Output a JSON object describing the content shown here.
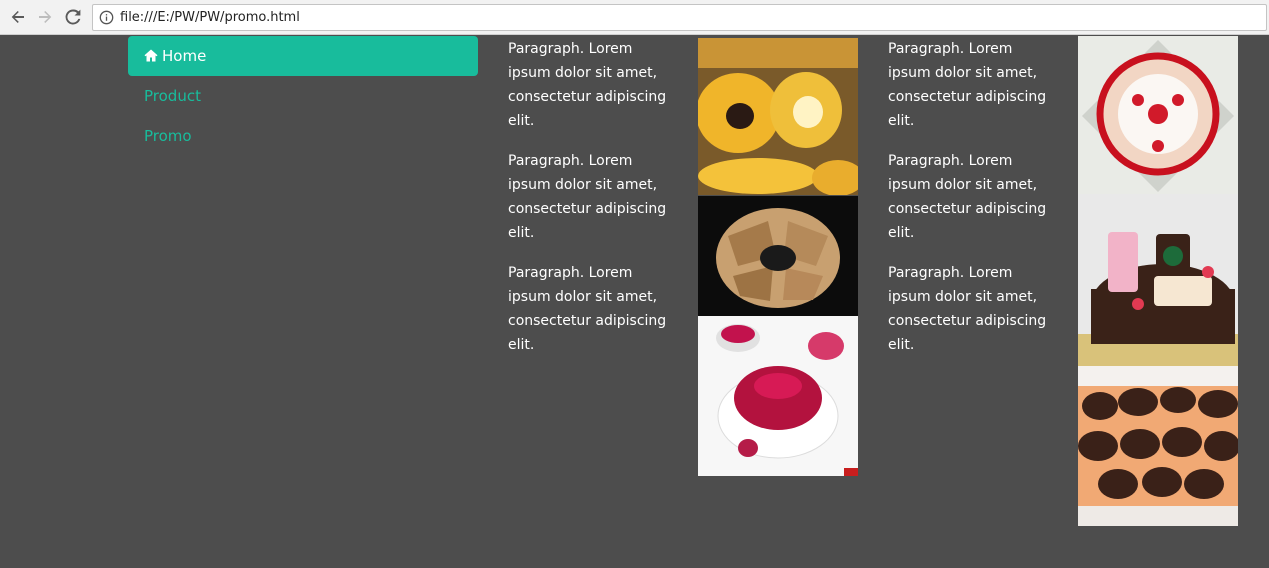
{
  "browser": {
    "url": "file:///E:/PW/PW/promo.html"
  },
  "sidebar": {
    "items": [
      {
        "label": "Home",
        "icon": "home-icon",
        "active": true
      },
      {
        "label": "Product",
        "active": false
      },
      {
        "label": "Promo",
        "active": false
      }
    ]
  },
  "main": {
    "column_a": {
      "paragraphs": [
        "Paragraph. Lorem ipsum dolor sit amet, consectetur adipiscing elit.",
        "Paragraph. Lorem ipsum dolor sit amet, consectetur adipiscing elit.",
        "Paragraph. Lorem ipsum dolor sit amet, consectetur adipiscing elit."
      ]
    },
    "column_b": {
      "paragraphs": [
        "Paragraph. Lorem ipsum dolor sit amet, consectetur adipiscing elit.",
        "Paragraph. Lorem ipsum dolor sit amet, consectetur adipiscing elit.",
        "Paragraph. Lorem ipsum dolor sit amet, consectetur adipiscing elit."
      ]
    }
  },
  "colors": {
    "page_background": "#4d4d4d",
    "accent": "#18bc9c",
    "text": "#ffffff"
  }
}
